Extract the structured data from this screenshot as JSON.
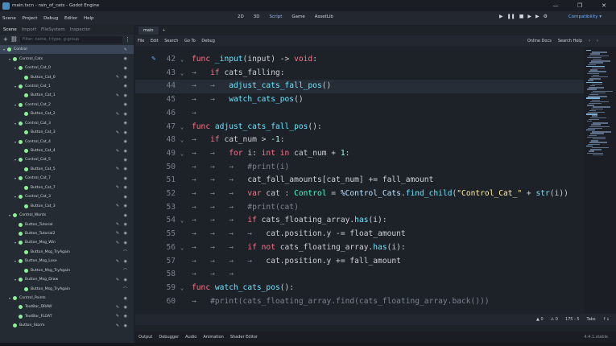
{
  "window": {
    "title": "main.tscn - rain_of_cats - Godot Engine",
    "controls": [
      "—",
      "❐",
      "✕"
    ]
  },
  "menubar": {
    "menus": [
      "Scene",
      "Project",
      "Debug",
      "Editor",
      "Help"
    ],
    "workspaces": [
      "2D",
      "3D",
      "Script",
      "Game",
      "AssetLib"
    ],
    "active_workspace": "Script",
    "run_buttons": [
      "▶",
      "❚❚",
      "■",
      "▶",
      "▶",
      "⚙"
    ],
    "renderer": "Compatibility ▾"
  },
  "scene_dock": {
    "tabs": [
      "Scene",
      "Import",
      "FileSystem",
      "Inspector"
    ],
    "active_tab": "Scene",
    "filter_placeholder": "Filter: name, t:type, g:group",
    "nodes": [
      {
        "label": "Control",
        "indent": 0,
        "icon": "green",
        "arrow": "▾",
        "selected": true,
        "acts": "✎"
      },
      {
        "label": "Control_Cats",
        "indent": 1,
        "icon": "green",
        "arrow": "▾",
        "acts": "◉"
      },
      {
        "label": "Control_Cat_0",
        "indent": 2,
        "icon": "green",
        "arrow": "▾",
        "acts": "◉"
      },
      {
        "label": "Button_Cat_0",
        "indent": 3,
        "icon": "green",
        "arrow": "",
        "acts": "✎ ◉"
      },
      {
        "label": "Control_Cat_1",
        "indent": 2,
        "icon": "green",
        "arrow": "▾",
        "acts": "◉"
      },
      {
        "label": "Button_Cat_1",
        "indent": 3,
        "icon": "green",
        "arrow": "",
        "acts": "✎ ◉"
      },
      {
        "label": "Control_Cat_2",
        "indent": 2,
        "icon": "green",
        "arrow": "▾",
        "acts": "◉"
      },
      {
        "label": "Button_Cat_2",
        "indent": 3,
        "icon": "green",
        "arrow": "",
        "acts": "✎ ◉"
      },
      {
        "label": "Control_Cat_3",
        "indent": 2,
        "icon": "green",
        "arrow": "▾",
        "acts": "◉"
      },
      {
        "label": "Button_Cat_3",
        "indent": 3,
        "icon": "green",
        "arrow": "",
        "acts": "✎ ◉"
      },
      {
        "label": "Control_Cat_4",
        "indent": 2,
        "icon": "green",
        "arrow": "▾",
        "acts": "◉"
      },
      {
        "label": "Button_Cat_4",
        "indent": 3,
        "icon": "green",
        "arrow": "",
        "acts": "✎ ◉"
      },
      {
        "label": "Control_Cat_5",
        "indent": 2,
        "icon": "green",
        "arrow": "▾",
        "acts": "◉"
      },
      {
        "label": "Button_Cat_5",
        "indent": 3,
        "icon": "green",
        "arrow": "",
        "acts": "✎ ◉"
      },
      {
        "label": "Control_Cat_7",
        "indent": 2,
        "icon": "green",
        "arrow": "▾",
        "acts": "◉"
      },
      {
        "label": "Button_Cat_7",
        "indent": 3,
        "icon": "green",
        "arrow": "",
        "acts": "✎ ◉"
      },
      {
        "label": "Control_Cat_3",
        "indent": 2,
        "icon": "green",
        "arrow": "▾",
        "acts": "◉"
      },
      {
        "label": "Button_Cat_3",
        "indent": 3,
        "icon": "green",
        "arrow": "",
        "acts": "✎ ◉"
      },
      {
        "label": "Control_Words",
        "indent": 1,
        "icon": "green",
        "arrow": "▾",
        "acts": "◉"
      },
      {
        "label": "Button_Tutorial",
        "indent": 2,
        "icon": "green",
        "arrow": "",
        "acts": "✎ ◉"
      },
      {
        "label": "Button_Tutorial2",
        "indent": 2,
        "icon": "green",
        "arrow": "",
        "acts": "✎ ◉"
      },
      {
        "label": "Button_Msg_Win",
        "indent": 2,
        "icon": "green",
        "arrow": "▾",
        "acts": "✎ ◉"
      },
      {
        "label": "Button_Msg_TryAgain",
        "indent": 3,
        "icon": "green",
        "arrow": "",
        "acts": "⌒"
      },
      {
        "label": "Button_Msg_Lose",
        "indent": 2,
        "icon": "green",
        "arrow": "▾",
        "acts": "✎ ◉"
      },
      {
        "label": "Button_Msg_TryAgain",
        "indent": 3,
        "icon": "green",
        "arrow": "",
        "acts": "⌒"
      },
      {
        "label": "Button_Msg_Draw",
        "indent": 2,
        "icon": "green",
        "arrow": "▾",
        "acts": "✎ ◉"
      },
      {
        "label": "Button_Msg_TryAgain",
        "indent": 3,
        "icon": "green",
        "arrow": "",
        "acts": "⌒"
      },
      {
        "label": "Control_Points",
        "indent": 1,
        "icon": "green",
        "arrow": "▾",
        "acts": "◉"
      },
      {
        "label": "TextBar_DRAW",
        "indent": 2,
        "icon": "green",
        "arrow": "",
        "acts": "✎ ◉"
      },
      {
        "label": "TextBar_FLOAT",
        "indent": 2,
        "icon": "green",
        "arrow": "",
        "acts": "✎ ◉"
      },
      {
        "label": "Button_Storm",
        "indent": 1,
        "icon": "green",
        "arrow": "",
        "acts": "✎ ◉"
      }
    ]
  },
  "editor": {
    "tabs": [
      "main"
    ],
    "add_tab": "+",
    "script_menu": [
      "File",
      "Edit",
      "Search",
      "Go To",
      "Debug"
    ],
    "script_menu_right": [
      "Online Docs",
      "Search Help",
      "‹",
      "›"
    ],
    "highlighted_line": 44,
    "lines": [
      {
        "n": "42",
        "fold": "⌄",
        "tokens": [
          [
            "kw",
            "func "
          ],
          [
            "fn",
            "_input"
          ],
          [
            "id",
            "(input) -> "
          ],
          [
            "kw",
            "void"
          ],
          [
            "id",
            ":"
          ]
        ]
      },
      {
        "n": "43",
        "fold": "⌄",
        "tokens": [
          [
            "cm",
            "→   "
          ],
          [
            "kw",
            "if "
          ],
          [
            "id",
            "cats_falling:"
          ]
        ]
      },
      {
        "n": "44",
        "fold": "",
        "tokens": [
          [
            "cm",
            "→   →   "
          ],
          [
            "fn",
            "adjust_cats_fall_pos"
          ],
          [
            "id",
            "()"
          ]
        ]
      },
      {
        "n": "45",
        "fold": "",
        "tokens": [
          [
            "cm",
            "→   →   "
          ],
          [
            "fn",
            "watch_cats_pos"
          ],
          [
            "id",
            "()"
          ]
        ]
      },
      {
        "n": "46",
        "fold": "",
        "tokens": [
          [
            "cm",
            "→   "
          ]
        ]
      },
      {
        "n": "47",
        "fold": "⌄",
        "tokens": [
          [
            "kw",
            "func "
          ],
          [
            "fn",
            "adjust_cats_fall_pos"
          ],
          [
            "id",
            "():"
          ]
        ]
      },
      {
        "n": "48",
        "fold": "⌄",
        "tokens": [
          [
            "cm",
            "→   "
          ],
          [
            "kw",
            "if "
          ],
          [
            "id",
            "cat_num > "
          ],
          [
            "num",
            "-1"
          ],
          [
            "id",
            ":"
          ]
        ]
      },
      {
        "n": "49",
        "fold": "⌄",
        "tokens": [
          [
            "cm",
            "→   →   "
          ],
          [
            "kw",
            "for "
          ],
          [
            "id",
            "i: "
          ],
          [
            "kw",
            "int in "
          ],
          [
            "id",
            "cat_num + "
          ],
          [
            "num",
            "1"
          ],
          [
            "id",
            ":"
          ]
        ]
      },
      {
        "n": "50",
        "fold": "",
        "tokens": [
          [
            "cm",
            "→   →   →   #print(i)"
          ]
        ]
      },
      {
        "n": "51",
        "fold": "",
        "tokens": [
          [
            "cm",
            "→   →   →   "
          ],
          [
            "id",
            "cat_fall_amounts[cat_num] += fall_amount"
          ]
        ]
      },
      {
        "n": "52",
        "fold": "",
        "tokens": [
          [
            "cm",
            "→   →   →   "
          ],
          [
            "kw",
            "var "
          ],
          [
            "id",
            "cat : "
          ],
          [
            "ty",
            "Control"
          ],
          [
            "id",
            " = "
          ],
          [
            "np",
            "%Control_Cats"
          ],
          [
            "id",
            "."
          ],
          [
            "fn",
            "find_child"
          ],
          [
            "id",
            "("
          ],
          [
            "str",
            "\"Control_Cat_\""
          ],
          [
            "id",
            " + "
          ],
          [
            "fn",
            "str"
          ],
          [
            "id",
            "(i))"
          ]
        ]
      },
      {
        "n": "53",
        "fold": "",
        "tokens": [
          [
            "cm",
            "→   →   →   #print(cat)"
          ]
        ]
      },
      {
        "n": "54",
        "fold": "⌄",
        "tokens": [
          [
            "cm",
            "→   →   →   "
          ],
          [
            "kw",
            "if "
          ],
          [
            "id",
            "cats_floating_array."
          ],
          [
            "fn",
            "has"
          ],
          [
            "id",
            "(i):"
          ]
        ]
      },
      {
        "n": "55",
        "fold": "",
        "tokens": [
          [
            "cm",
            "→   →   →   →   "
          ],
          [
            "id",
            "cat.position.y -= float_amount"
          ]
        ]
      },
      {
        "n": "56",
        "fold": "⌄",
        "tokens": [
          [
            "cm",
            "→   →   →   "
          ],
          [
            "kw",
            "if not "
          ],
          [
            "id",
            "cats_floating_array."
          ],
          [
            "fn",
            "has"
          ],
          [
            "id",
            "(i):"
          ]
        ]
      },
      {
        "n": "57",
        "fold": "",
        "tokens": [
          [
            "cm",
            "→   →   →   →   "
          ],
          [
            "id",
            "cat.position.y += fall_amount"
          ]
        ]
      },
      {
        "n": "58",
        "fold": "",
        "tokens": [
          [
            "cm",
            "→   →   →   "
          ]
        ]
      },
      {
        "n": "59",
        "fold": "⌄",
        "tokens": [
          [
            "kw",
            "func "
          ],
          [
            "fn",
            "watch_cats_pos"
          ],
          [
            "id",
            "():"
          ]
        ]
      },
      {
        "n": "60",
        "fold": "",
        "tokens": [
          [
            "cm",
            "→   #print(cats_floating_array.find(cats_floating_array.back()))"
          ]
        ]
      }
    ]
  },
  "statusbar": {
    "items": [
      "▲ 0",
      "⚠ 0",
      "175 : 5",
      "Tabs",
      "↑↓"
    ]
  },
  "bottom_panel": {
    "tabs": [
      "Output",
      "Debugger",
      "Audio",
      "Animation",
      "Shader Editor"
    ],
    "version": "4.4.1.stable"
  }
}
